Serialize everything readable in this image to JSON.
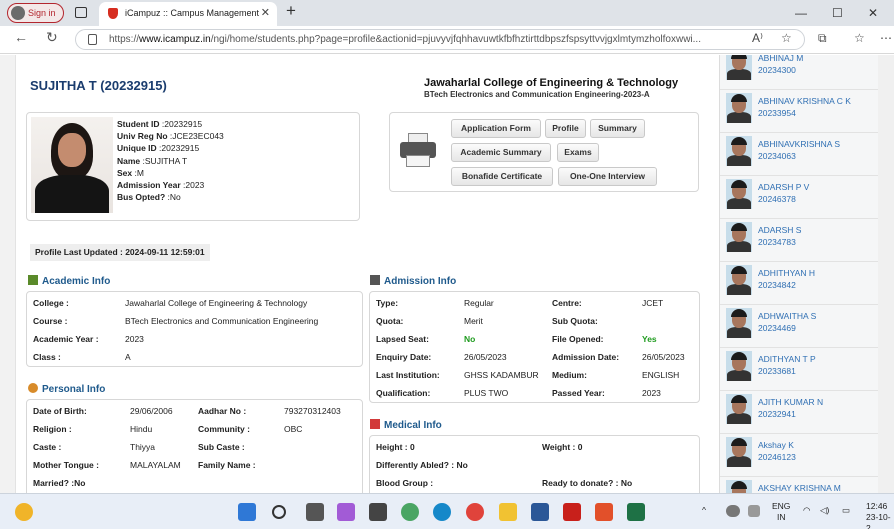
{
  "browser": {
    "signin": "Sign in",
    "tab_title": "iCampuz :: Campus Management",
    "url_prefix": "https://",
    "url_host": "www.icampuz.in",
    "url_path": "/ngi/home/students.php?page=profile&actionid=pjuvyvjfqhhavuwtkfbfhztirttdbpszfspsyttvvjgxlmtymzholfoxwwi..."
  },
  "header": {
    "student_name": "SUJITHA T (20232915)",
    "college_name": "Jawaharlal College of Engineering & Technology",
    "department": "BTech Electronics and Communication Engineering-2023-A"
  },
  "profile": {
    "lines": [
      {
        "k": "Student ID",
        "v": ":20232915"
      },
      {
        "k": "Univ Reg No",
        "v": ":JCE23EC043"
      },
      {
        "k": "Unique ID",
        "v": ":20232915"
      },
      {
        "k": "Name",
        "v": ":SUJITHA T"
      },
      {
        "k": "Sex",
        "v": ":M"
      },
      {
        "k": "Admission Year",
        "v": ":2023"
      },
      {
        "k": "Bus Opted?",
        "v": ":No"
      }
    ],
    "last_updated": "Profile Last Updated : 2024-09-11 12:59:01"
  },
  "actions": {
    "application_form": "Application Form",
    "profile": "Profile",
    "summary": "Summary",
    "academic_summary": "Academic Summary",
    "exams": "Exams",
    "bonafide": "Bonafide Certificate",
    "interview": "One-One Interview"
  },
  "academic": {
    "title": "Academic Info",
    "college_k": "College :",
    "college_v": "Jawaharlal College of Engineering & Technology",
    "course_k": "Course :",
    "course_v": "BTech Electronics and Communication Engineering",
    "year_k": "Academic Year :",
    "year_v": "2023",
    "class_k": "Class :",
    "class_v": "A"
  },
  "admission": {
    "title": "Admission Info",
    "type_k": "Type:",
    "type_v": "Regular",
    "centre_k": "Centre:",
    "centre_v": "JCET",
    "quota_k": "Quota:",
    "quota_v": "Merit",
    "subquota_k": "Sub Quota:",
    "lapsed_k": "Lapsed Seat:",
    "lapsed_v": "No",
    "fileopened_k": "File Opened:",
    "fileopened_v": "Yes",
    "enquiry_k": "Enquiry Date:",
    "enquiry_v": "26/05/2023",
    "admdate_k": "Admission Date:",
    "admdate_v": "26/05/2023",
    "lastinst_k": "Last Institution:",
    "lastinst_v": "GHSS KADAMBUR",
    "medium_k": "Medium:",
    "medium_v": "ENGLISH",
    "qual_k": "Qualification:",
    "qual_v": "PLUS TWO",
    "passed_k": "Passed Year:",
    "passed_v": "2023"
  },
  "personal": {
    "title": "Personal Info",
    "dob_k": "Date of Birth:",
    "dob_v": "29/06/2006",
    "aadhar_k": "Aadhar No :",
    "aadhar_v": "793270312403",
    "religion_k": "Religion :",
    "religion_v": "Hindu",
    "community_k": "Community :",
    "community_v": "OBC",
    "caste_k": "Caste :",
    "caste_v": "Thiyya",
    "subcaste_k": "Sub Caste :",
    "tongue_k": "Mother Tongue :",
    "tongue_v": "MALAYALAM",
    "family_k": "Family Name :",
    "married": "Married? :No"
  },
  "medical": {
    "title": "Medical Info",
    "height": "Height : 0",
    "weight": "Weight : 0",
    "abled": "Differently Abled? : No",
    "blood": "Blood Group :",
    "donate": "Ready to donate? : No"
  },
  "sidebar": {
    "students": [
      {
        "name": "ABHINAJ M",
        "id": "20234300"
      },
      {
        "name": "ABHINAV KRISHNA C K",
        "id": "20233954"
      },
      {
        "name": "ABHINAVKRISHNA S",
        "id": "20234063"
      },
      {
        "name": "ADARSH P V",
        "id": "20246378"
      },
      {
        "name": "ADARSH S",
        "id": "20234783"
      },
      {
        "name": "ADHITHYAN H",
        "id": "20234842"
      },
      {
        "name": "ADHWAITHA S",
        "id": "20234469"
      },
      {
        "name": "ADITHYAN T P",
        "id": "20233681"
      },
      {
        "name": "AJITH KUMAR N",
        "id": "20232941"
      },
      {
        "name": "Akshay K",
        "id": "20246123"
      },
      {
        "name": "AKSHAY KRISHNA M",
        "id": ""
      }
    ]
  },
  "taskbar": {
    "lang_1": "ENG",
    "lang_2": "IN",
    "time": "12:46",
    "date": "23-10-2"
  }
}
